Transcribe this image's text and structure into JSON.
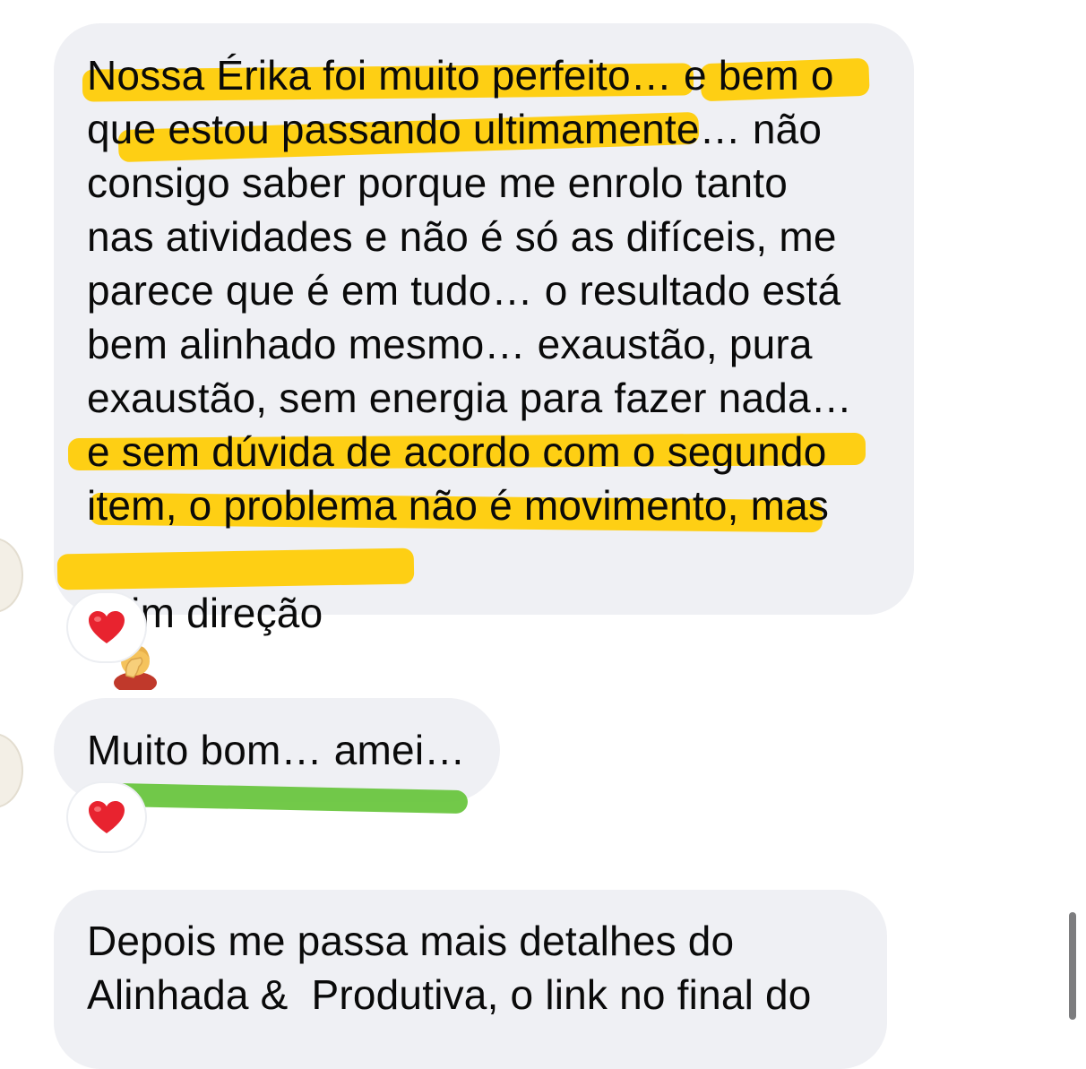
{
  "colors": {
    "bubble": "#eff0f4",
    "highlight_yellow": "#ffcc00",
    "highlight_green": "#66c43a",
    "heart": "#e8232f"
  },
  "messages": [
    {
      "lines": [
        "Nossa Érika foi muito perfeito… e bem o",
        "que estou passando ultimamente… não",
        "consigo saber porque me enrolo tanto",
        "nas atividades e não é só as difíceis, me",
        "parece que é em tudo… o resultado está",
        "bem alinhado mesmo… exaustão, pura",
        "exaustão, sem energia para fazer nada…",
        "e sem dúvida de acordo com o segundo",
        "item, o problema não é movimento, mas",
        "sim direção"
      ],
      "emoji": "facepalm-woman-icon",
      "reaction": "red-heart-icon"
    },
    {
      "lines": [
        "Muito bom… amei…"
      ],
      "reaction": "red-heart-icon"
    },
    {
      "lines": [
        "Depois me passa mais detalhes do",
        "Alinhada &  Produtiva, o link no final do"
      ]
    }
  ]
}
